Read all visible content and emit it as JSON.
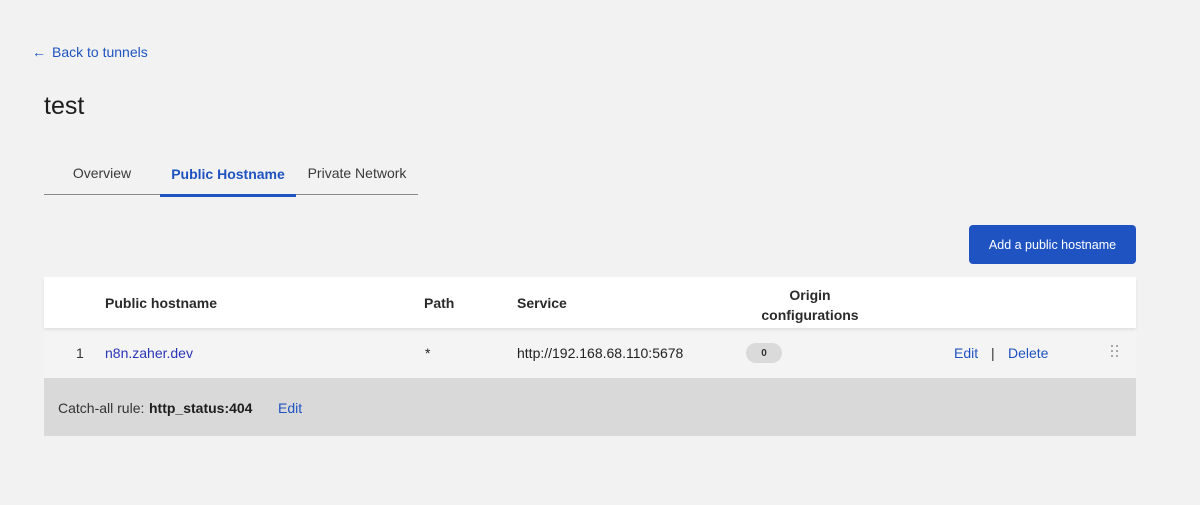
{
  "nav": {
    "back_label": "Back to tunnels",
    "back_icon": "arrow-left-icon"
  },
  "page": {
    "title": "test"
  },
  "tabs": [
    {
      "label": "Overview",
      "active": false
    },
    {
      "label": "Public Hostname",
      "active": true
    },
    {
      "label": "Private Network",
      "active": false
    }
  ],
  "actions": {
    "add_label": "Add a public hostname"
  },
  "table": {
    "headers": {
      "hostname": "Public hostname",
      "path": "Path",
      "service": "Service",
      "origin_line1": "Origin",
      "origin_line2": "configurations"
    },
    "rows": [
      {
        "index": "1",
        "hostname": "n8n.zaher.dev",
        "path": "*",
        "service": "http://192.168.68.110:5678",
        "origin_count": "0",
        "edit_label": "Edit",
        "separator": "|",
        "delete_label": "Delete"
      }
    ],
    "catch_all": {
      "label": "Catch-all rule:",
      "value": "http_status:404",
      "edit_label": "Edit"
    }
  },
  "colors": {
    "accent": "#1f54c0",
    "background": "#f2f2f2",
    "catch_all_bg": "#d9d9d9"
  }
}
